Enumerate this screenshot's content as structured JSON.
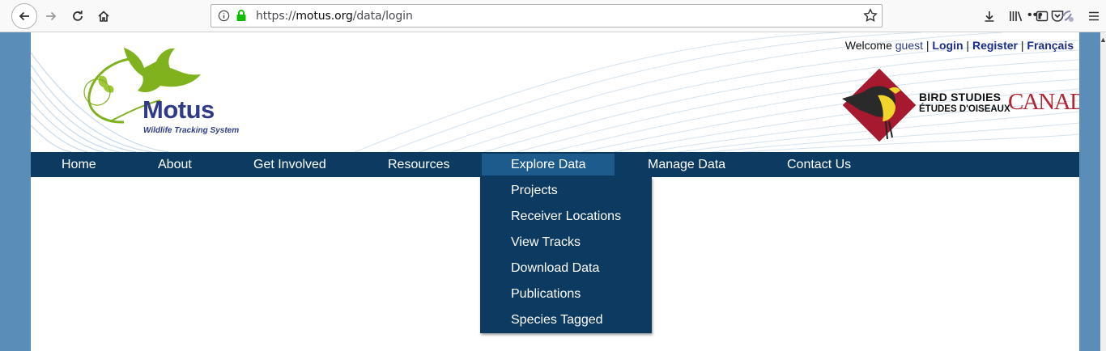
{
  "browser": {
    "url_prefix": "https://",
    "url_host": "motus.org",
    "url_path": "/data/login",
    "page_actions": "•••"
  },
  "header": {
    "welcome_prefix": "Welcome",
    "user": "guest",
    "sep1": "|",
    "login": "Login",
    "sep2": "|",
    "register": "Register",
    "sep3": "|",
    "language": "Français",
    "logo_title": "Motus",
    "logo_subtitle": "Wildlife Tracking System",
    "partner_line1": "BIRD STUDIES",
    "partner_line2": "ÉTUDES D'OISEAUX",
    "partner_canada": "CANADA"
  },
  "nav": {
    "items": [
      {
        "label": "Home"
      },
      {
        "label": "About"
      },
      {
        "label": "Get Involved"
      },
      {
        "label": "Resources"
      },
      {
        "label": "Explore Data"
      },
      {
        "label": "Manage Data"
      },
      {
        "label": "Contact Us"
      }
    ],
    "active": "Explore Data"
  },
  "dropdown": {
    "items": [
      {
        "label": "Projects"
      },
      {
        "label": "Receiver Locations"
      },
      {
        "label": "View Tracks"
      },
      {
        "label": "Download Data"
      },
      {
        "label": "Publications"
      },
      {
        "label": "Species Tagged"
      }
    ]
  },
  "colors": {
    "nav_bg": "#0c3a60",
    "nav_active": "#1d5b8d",
    "side_bg": "#5a8db8",
    "motus_blue": "#2f3b87",
    "motus_green": "#7fb21d",
    "bsc_red": "#b22531"
  }
}
